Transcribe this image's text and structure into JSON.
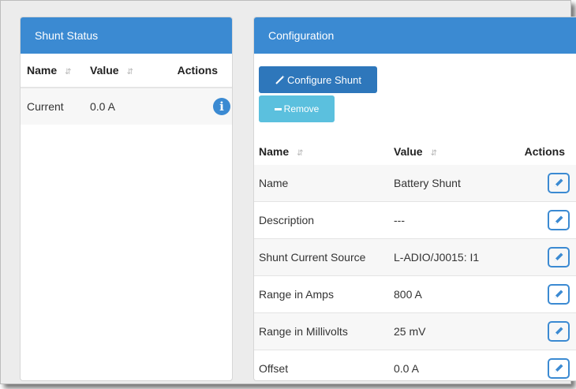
{
  "shunt_status": {
    "title": "Shunt Status",
    "columns": {
      "name": "Name",
      "value": "Value",
      "actions": "Actions"
    },
    "rows": [
      {
        "name": "Current",
        "value": "0.0 A",
        "action_icon": "info-icon"
      }
    ]
  },
  "configuration": {
    "title": "Configuration",
    "configure_button": "Configure Shunt",
    "remove_button": "Remove",
    "columns": {
      "name": "Name",
      "value": "Value",
      "actions": "Actions"
    },
    "rows": [
      {
        "name": "Name",
        "value": "Battery Shunt",
        "action_icon": "edit-icon"
      },
      {
        "name": "Description",
        "value": "---",
        "action_icon": "edit-icon"
      },
      {
        "name": "Shunt Current Source",
        "value": "L-ADIO/J0015: I1",
        "action_icon": "edit-icon"
      },
      {
        "name": "Range in Amps",
        "value": "800 A",
        "action_icon": "edit-icon"
      },
      {
        "name": "Range in Millivolts",
        "value": "25 mV",
        "action_icon": "edit-icon"
      },
      {
        "name": "Offset",
        "value": "0.0 A",
        "action_icon": "edit-icon"
      }
    ]
  },
  "colors": {
    "header_blue": "#3b8ad2",
    "primary_button": "#2e77bb",
    "info_button": "#5bc0de"
  }
}
